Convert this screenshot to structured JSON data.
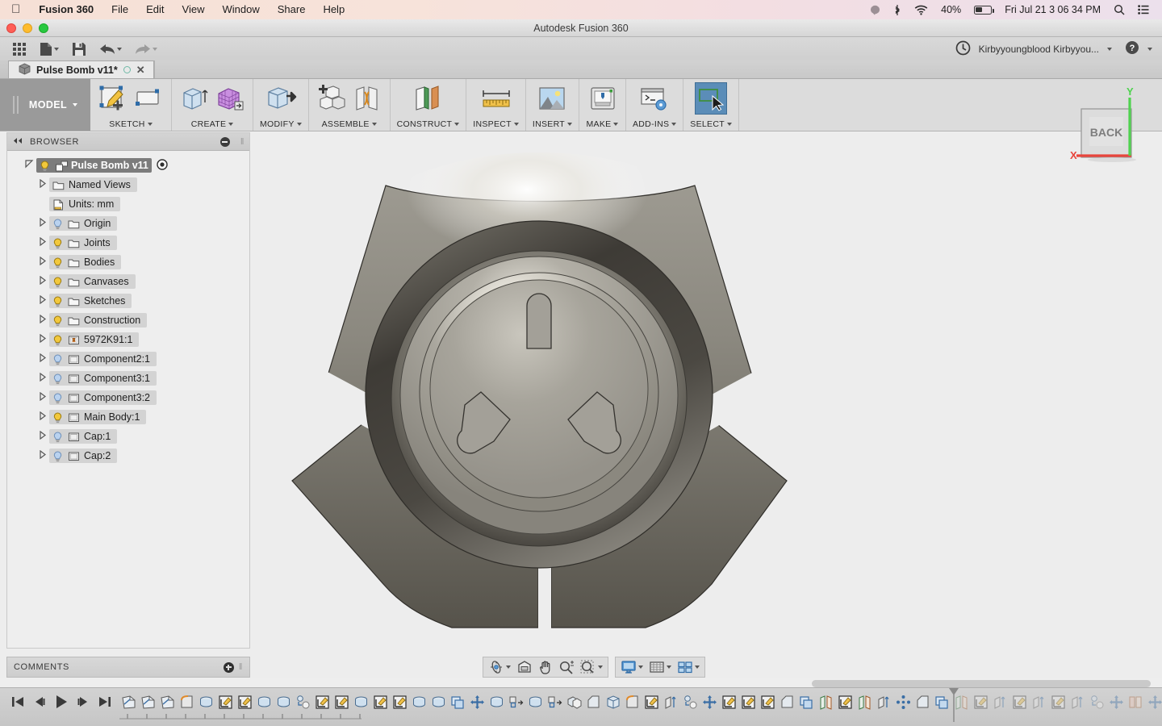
{
  "menubar": {
    "apple_icon": "apple-icon",
    "items": [
      "Fusion 360",
      "File",
      "Edit",
      "View",
      "Window",
      "Share",
      "Help"
    ],
    "status": {
      "siri_icon": "siri-icon",
      "bluetooth_icon": "bluetooth-icon",
      "wifi_icon": "wifi-icon",
      "battery_percent": "40%",
      "battery_icon": "battery-icon",
      "clock": "Fri Jul 21  3 06 34 PM",
      "search_icon": "spotlight-search-icon",
      "notifications_icon": "notification-center-icon"
    }
  },
  "window": {
    "title": "Autodesk Fusion 360",
    "close_label": "close-window",
    "minimize_label": "minimize-window",
    "zoom_label": "zoom-window"
  },
  "quickbar": {
    "buttons": [
      {
        "name": "app-grid-button",
        "icon": "grid-apps-icon",
        "caret": false
      },
      {
        "name": "new-file-button",
        "icon": "file-icon",
        "caret": true
      },
      {
        "name": "save-button",
        "icon": "save-floppy-icon",
        "caret": false
      },
      {
        "name": "undo-button",
        "icon": "undo-arrow-icon",
        "caret": true
      },
      {
        "name": "redo-button",
        "icon": "redo-arrow-icon",
        "caret": true
      }
    ],
    "right": {
      "history_icon": "clock-history-icon",
      "account_label": "Kirbyyoungblood Kirbyyou...",
      "help_icon": "help-question-icon"
    }
  },
  "document_tab": {
    "icon": "cube-document-icon",
    "title": "Pulse Bomb v11*",
    "unsaved_indicator": "circle-indicator",
    "close_label": "✕"
  },
  "ribbon": {
    "workspace": "MODEL",
    "groups": [
      {
        "label": "SKETCH",
        "name": "group-sketch",
        "icons": [
          "create-sketch-icon",
          "rectangle-sketch-icon"
        ],
        "selected": false
      },
      {
        "label": "CREATE",
        "name": "group-create",
        "icons": [
          "extrude-icon",
          "mesh-box-icon"
        ],
        "selected": false
      },
      {
        "label": "MODIFY",
        "name": "group-modify",
        "icons": [
          "press-pull-icon"
        ],
        "selected": false
      },
      {
        "label": "ASSEMBLE",
        "name": "group-assemble",
        "icons": [
          "new-component-icon",
          "joint-icon"
        ],
        "selected": false
      },
      {
        "label": "CONSTRUCT",
        "name": "group-construct",
        "icons": [
          "offset-plane-icon"
        ],
        "selected": false
      },
      {
        "label": "INSPECT",
        "name": "group-inspect",
        "icons": [
          "measure-ruler-icon"
        ],
        "selected": false
      },
      {
        "label": "INSERT",
        "name": "group-insert",
        "icons": [
          "insert-image-icon"
        ],
        "selected": false
      },
      {
        "label": "MAKE",
        "name": "group-make",
        "icons": [
          "3d-print-icon"
        ],
        "selected": false
      },
      {
        "label": "ADD-INS",
        "name": "group-addins",
        "icons": [
          "script-addin-icon"
        ],
        "selected": false
      },
      {
        "label": "SELECT",
        "name": "group-select",
        "icons": [
          "select-cursor-icon"
        ],
        "selected": true
      }
    ]
  },
  "browser": {
    "header": "BROWSER",
    "collapse_icon": "collapse-left-icon",
    "minimize_icon": "minimize-panel-icon",
    "tree": [
      {
        "label": "Pulse Bomb v11",
        "indent": 0,
        "arrow": "expanded",
        "icon": "component-icon",
        "bulb": "none",
        "root": true,
        "radio": true
      },
      {
        "label": "Named Views",
        "indent": 1,
        "arrow": "collapsed",
        "icon": "folder-icon",
        "bulb": "none"
      },
      {
        "label": "Units: mm",
        "indent": 1,
        "arrow": "none",
        "icon": "units-doc-icon",
        "bulb": "none"
      },
      {
        "label": "Origin",
        "indent": 1,
        "arrow": "collapsed",
        "icon": "folder-icon",
        "bulb": "off"
      },
      {
        "label": "Joints",
        "indent": 1,
        "arrow": "collapsed",
        "icon": "folder-icon",
        "bulb": "on"
      },
      {
        "label": "Bodies",
        "indent": 1,
        "arrow": "collapsed",
        "icon": "folder-icon",
        "bulb": "on"
      },
      {
        "label": "Canvases",
        "indent": 1,
        "arrow": "collapsed",
        "icon": "folder-icon",
        "bulb": "on"
      },
      {
        "label": "Sketches",
        "indent": 1,
        "arrow": "collapsed",
        "icon": "folder-icon",
        "bulb": "on"
      },
      {
        "label": "Construction",
        "indent": 1,
        "arrow": "collapsed",
        "icon": "folder-icon",
        "bulb": "on"
      },
      {
        "label": "5972K91:1",
        "indent": 1,
        "arrow": "collapsed",
        "icon": "linked-component-icon",
        "bulb": "on"
      },
      {
        "label": "Component2:1",
        "indent": 1,
        "arrow": "collapsed",
        "icon": "component-box-icon",
        "bulb": "off"
      },
      {
        "label": "Component3:1",
        "indent": 1,
        "arrow": "collapsed",
        "icon": "component-box-icon",
        "bulb": "off"
      },
      {
        "label": "Component3:2",
        "indent": 1,
        "arrow": "collapsed",
        "icon": "component-box-icon",
        "bulb": "off"
      },
      {
        "label": "Main Body:1",
        "indent": 1,
        "arrow": "collapsed",
        "icon": "component-box-icon",
        "bulb": "on"
      },
      {
        "label": "Cap:1",
        "indent": 1,
        "arrow": "collapsed",
        "icon": "component-box-icon",
        "bulb": "off"
      },
      {
        "label": "Cap:2",
        "indent": 1,
        "arrow": "collapsed",
        "icon": "component-box-icon",
        "bulb": "off"
      }
    ]
  },
  "viewcube": {
    "face_label": "BACK",
    "axis_x": "X",
    "axis_y": "Y",
    "axis_x_color": "#e8453c",
    "axis_y_color": "#4fd24f"
  },
  "navbar": {
    "group_a": [
      {
        "name": "orbit-button",
        "icon": "orbit-icon",
        "caret": true
      },
      {
        "name": "look-at-button",
        "icon": "look-at-icon",
        "caret": false
      },
      {
        "name": "pan-button",
        "icon": "pan-hand-icon",
        "caret": false
      },
      {
        "name": "zoom-button",
        "icon": "zoom-magnifier-icon",
        "caret": false
      },
      {
        "name": "fit-button",
        "icon": "zoom-fit-icon",
        "caret": true
      }
    ],
    "group_b": [
      {
        "name": "display-settings-button",
        "icon": "display-monitor-icon",
        "caret": true
      },
      {
        "name": "grid-snaps-button",
        "icon": "grid-icon",
        "caret": true
      },
      {
        "name": "viewports-button",
        "icon": "viewports-icon",
        "caret": true
      }
    ]
  },
  "comments": {
    "header": "COMMENTS",
    "add_icon": "add-comment-icon"
  },
  "timeline": {
    "playback": [
      {
        "name": "timeline-begin-button",
        "icon": "skip-to-start-icon"
      },
      {
        "name": "timeline-step-back-button",
        "icon": "step-back-icon"
      },
      {
        "name": "timeline-play-button",
        "icon": "play-icon"
      },
      {
        "name": "timeline-step-forward-button",
        "icon": "step-forward-icon"
      },
      {
        "name": "timeline-end-button",
        "icon": "skip-to-end-icon"
      }
    ],
    "features": [
      {
        "icon": "sketch-feature-icon",
        "dim": false
      },
      {
        "icon": "sketch-feature-icon",
        "dim": false
      },
      {
        "icon": "sketch-feature-icon",
        "dim": false
      },
      {
        "icon": "fillet-feature-icon",
        "dim": false
      },
      {
        "icon": "revolve-feature-icon",
        "dim": false
      },
      {
        "icon": "sketch-plane-icon",
        "dim": false
      },
      {
        "icon": "sketch-plane-icon",
        "dim": false
      },
      {
        "icon": "revolve-feature-icon",
        "dim": false
      },
      {
        "icon": "revolve-feature-icon",
        "dim": false
      },
      {
        "icon": "copy-paste-icon",
        "dim": false
      },
      {
        "icon": "sketch-plane-icon",
        "dim": false
      },
      {
        "icon": "sketch-plane-icon",
        "dim": false
      },
      {
        "icon": "revolve-feature-icon",
        "dim": false
      },
      {
        "icon": "sketch-plane-icon",
        "dim": false
      },
      {
        "icon": "sketch-plane-icon",
        "dim": false
      },
      {
        "icon": "revolve-feature-icon",
        "dim": false
      },
      {
        "icon": "revolve-feature-icon",
        "dim": false
      },
      {
        "icon": "component-copy-icon",
        "dim": false
      },
      {
        "icon": "move-feature-icon",
        "dim": false
      },
      {
        "icon": "revolve-feature-icon",
        "dim": false
      },
      {
        "icon": "align-feature-icon",
        "dim": false
      },
      {
        "icon": "revolve-feature-icon",
        "dim": false
      },
      {
        "icon": "align-feature-icon",
        "dim": false
      },
      {
        "icon": "combine-feature-icon",
        "dim": false
      },
      {
        "icon": "chamfer-feature-icon",
        "dim": false
      },
      {
        "icon": "shell-feature-icon",
        "dim": false
      },
      {
        "icon": "fillet-feature-icon",
        "dim": false
      },
      {
        "icon": "sketch-plane-icon",
        "dim": false
      },
      {
        "icon": "extrude-feature-icon",
        "dim": false
      },
      {
        "icon": "copy-paste-icon",
        "dim": false
      },
      {
        "icon": "move-feature-icon",
        "dim": false
      },
      {
        "icon": "sketch-plane-icon",
        "dim": false
      },
      {
        "icon": "sketch-plane-icon",
        "dim": false
      },
      {
        "icon": "sketch-plane-icon",
        "dim": false
      },
      {
        "icon": "chamfer-feature-icon",
        "dim": false
      },
      {
        "icon": "component-copy-icon",
        "dim": false
      },
      {
        "icon": "mirror-feature-icon",
        "dim": false
      },
      {
        "icon": "sketch-plane-icon",
        "dim": false
      },
      {
        "icon": "mirror-feature-icon",
        "dim": false
      },
      {
        "icon": "extrude-feature-icon",
        "dim": false
      },
      {
        "icon": "pattern-feature-icon",
        "dim": false
      },
      {
        "icon": "chamfer-feature-icon",
        "dim": false
      },
      {
        "icon": "component-copy-icon",
        "dim": false
      },
      {
        "icon": "mirror-feature-icon",
        "dim": true
      },
      {
        "icon": "sketch-plane-icon",
        "dim": true
      },
      {
        "icon": "extrude-feature-icon",
        "dim": true
      },
      {
        "icon": "sketch-plane-icon",
        "dim": true
      },
      {
        "icon": "extrude-feature-icon",
        "dim": true
      },
      {
        "icon": "sketch-plane-icon",
        "dim": true
      },
      {
        "icon": "extrude-feature-icon",
        "dim": true
      },
      {
        "icon": "copy-paste-icon",
        "dim": true
      },
      {
        "icon": "move-feature-icon",
        "dim": true
      },
      {
        "icon": "rib-feature-icon",
        "dim": true
      },
      {
        "icon": "move-feature-icon",
        "dim": true
      }
    ],
    "marker_position_index": 43,
    "settings_icon": "timeline-settings-gear-icon"
  },
  "model": {
    "name": "pulse-bomb-3d-model",
    "description": "Shaded tri-lobed disc body with recessed circular well and three socket cutouts",
    "background_color": "#ededed"
  }
}
